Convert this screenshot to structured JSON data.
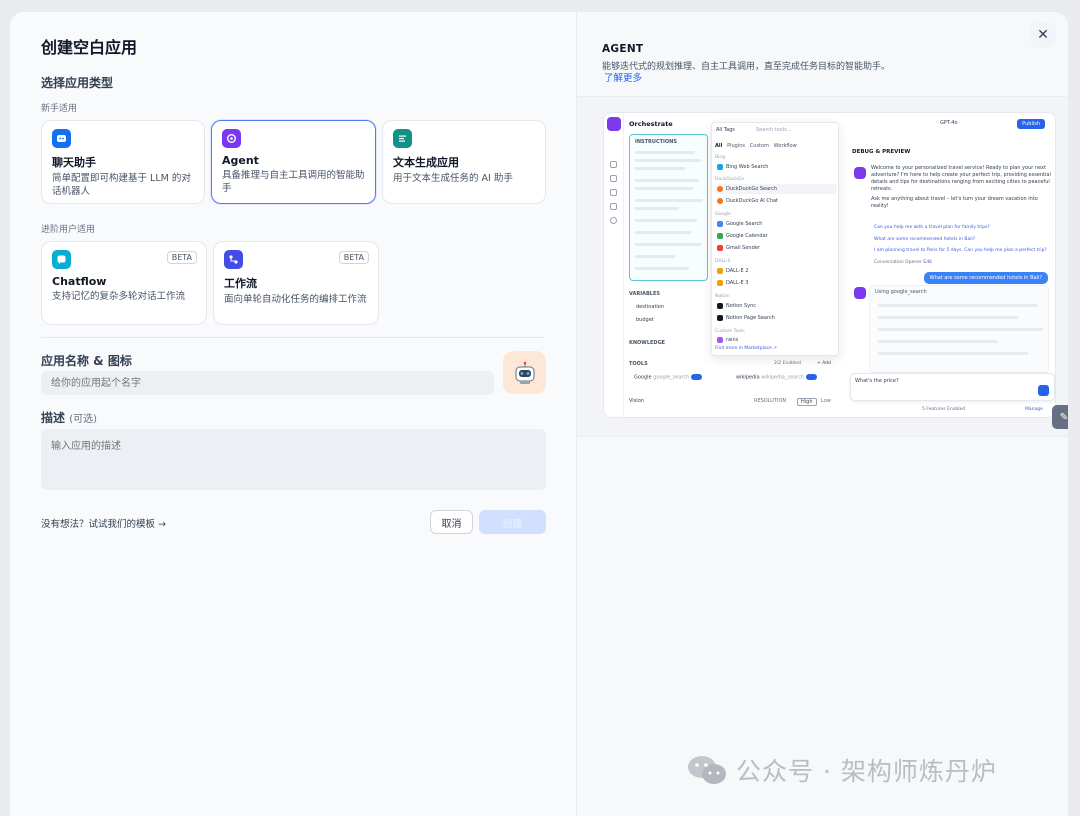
{
  "modal": {
    "title": "创建空白应用",
    "choose_type_label": "选择应用类型",
    "beginner_label": "新手适用",
    "advanced_label": "进阶用户适用",
    "cards": [
      {
        "name": "聊天助手",
        "desc": "简单配置即可构建基于 LLM 的对话机器人",
        "icon": "chat-bot-icon",
        "color": "#1570ef"
      },
      {
        "name": "Agent",
        "desc": "具备推理与自主工具调用的智能助手",
        "icon": "agent-icon",
        "color": "#7839ee",
        "selected": true
      },
      {
        "name": "文本生成应用",
        "desc": "用于文本生成任务的 AI 助手",
        "icon": "text-generator-icon",
        "color": "#0e9384"
      },
      {
        "name": "Chatflow",
        "desc": "支持记忆的复杂多轮对话工作流",
        "icon": "chatflow-icon",
        "color": "#06aed4",
        "badge": "BETA"
      },
      {
        "name": "工作流",
        "desc": "面向单轮自动化任务的编排工作流",
        "icon": "workflow-icon",
        "color": "#444ce7",
        "badge": "BETA"
      }
    ],
    "name_icon_label": "应用名称 & 图标",
    "name_placeholder": "给你的应用起个名字",
    "description_label": "描述",
    "description_optional": "(可选)",
    "description_placeholder": "输入应用的描述",
    "template_link": "没有想法？试试我们的模板 →",
    "cancel_label": "取消",
    "create_label": "创建"
  },
  "preview": {
    "title": "AGENT",
    "description": "能够迭代式的规划推理、自主工具调用，直至完成任务目标的智能助手。",
    "learn_more": "了解更多",
    "mini": {
      "orchestrate": "Orchestrate",
      "instructions": "INSTRUCTIONS",
      "model": "GPT-4o",
      "publish": "Publish",
      "all_tags": "All Tags",
      "search_tools": "Search tools...",
      "filter_chips": [
        "All",
        "Plugins",
        "Custom",
        "Workflow"
      ],
      "tool_groups": [
        {
          "group": "Bing",
          "items": [
            "Bing Web Search"
          ]
        },
        {
          "group": "DuckDuckGo",
          "items": [
            "DuckDuckGo Search",
            "DuckDuckGo AI Chat"
          ]
        },
        {
          "group": "Google",
          "items": [
            "Google Search",
            "Google Calendar",
            "Gmail Sender"
          ]
        },
        {
          "group": "DALL-E",
          "items": [
            "DALL-E 2",
            "DALL-E 3"
          ]
        },
        {
          "group": "Notion",
          "items": [
            "Notion Sync",
            "Notion Page Search"
          ]
        },
        {
          "group": "Custom Tools",
          "items": [
            "rains"
          ]
        }
      ],
      "find_more": "Find more in Marketplace ↗",
      "variables": "VARIABLES",
      "var1": "destination",
      "var2": "budget",
      "knowledge": "KNOWLEDGE",
      "tools": "TOOLS",
      "tools_enabled": "2/2 Enabled",
      "add": "+ Add",
      "tool1": "Google",
      "tool1_id": "google_search",
      "tool2": "wikipedia",
      "tool2_id": "wikipedia_search",
      "vision": "Vision",
      "resolution": "RESOLUTION",
      "high": "High",
      "low": "Low",
      "debug_preview": "DEBUG & PREVIEW",
      "welcome": "Welcome to your personalized travel service! Ready to plan your next adventure? I'm here to help create your perfect trip, providing essential details and tips for destinations ranging from exciting cities to peaceful retreats.",
      "ask_anything": "Ask me anything about travel – let's turn your dream vacation into reality!",
      "suggestions": [
        "Can you help me with a travel plan for family trips?",
        "What are some recommended hotels in Bali?",
        "I am planning travel to Paris for 5 days. Can you help me plan a perfect trip?"
      ],
      "conversation_opener": "Conversation Opener",
      "edit": "Edit",
      "user_msg": "What are some recommended hotels in Bali?",
      "using": "Using",
      "using_tool": "google_search",
      "input_text": "What's the price?",
      "features_enabled": "5 Features Enabled",
      "manage": "Manage"
    }
  },
  "watermark": "公众号 · 架构师炼丹炉"
}
